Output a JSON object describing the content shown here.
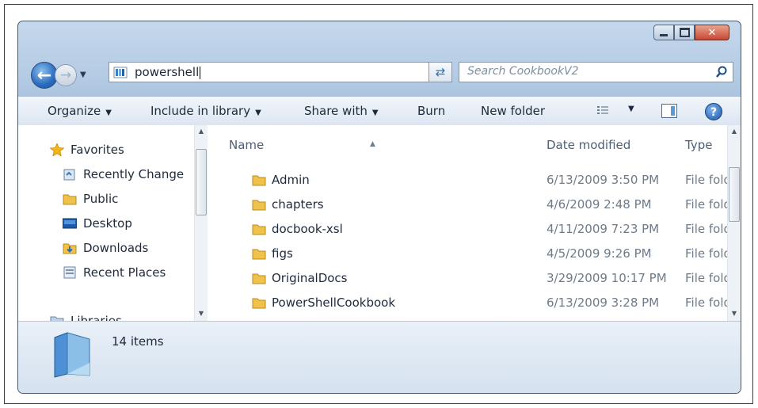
{
  "window": {
    "minimize_icon": "minimize-icon",
    "maximize_icon": "maximize-icon",
    "close_label": "✕"
  },
  "navigation": {
    "back_icon": "back-arrow-icon",
    "forward_icon": "forward-arrow-icon",
    "address_value": "powershell",
    "search_placeholder": "Search CookbookV2"
  },
  "toolbar": {
    "organize": "Organize",
    "include_in_library": "Include in library",
    "share_with": "Share with",
    "burn": "Burn",
    "new_folder": "New folder"
  },
  "sidebar": {
    "favorites": "Favorites",
    "items": [
      {
        "label": "Recently Change",
        "icon": "recent-changes-icon"
      },
      {
        "label": "Public",
        "icon": "folder-icon"
      },
      {
        "label": "Desktop",
        "icon": "desktop-icon"
      },
      {
        "label": "Downloads",
        "icon": "downloads-icon"
      },
      {
        "label": "Recent Places",
        "icon": "recent-places-icon"
      }
    ],
    "libraries": "Libraries"
  },
  "file_list": {
    "columns": {
      "name": "Name",
      "date": "Date modified",
      "type": "Type"
    },
    "rows": [
      {
        "name": "Admin",
        "date": "6/13/2009 3:50 PM",
        "type": "File folde"
      },
      {
        "name": "chapters",
        "date": "4/6/2009 2:48 PM",
        "type": "File folde"
      },
      {
        "name": "docbook-xsl",
        "date": "4/11/2009 7:23 PM",
        "type": "File folde"
      },
      {
        "name": "figs",
        "date": "4/5/2009 9:26 PM",
        "type": "File folde"
      },
      {
        "name": "OriginalDocs",
        "date": "3/29/2009 10:17 PM",
        "type": "File folde"
      },
      {
        "name": "PowerShellCookbook",
        "date": "6/13/2009 3:28 PM",
        "type": "File folde"
      }
    ]
  },
  "details": {
    "item_count": "14 items"
  },
  "colors": {
    "chrome": "#b9cfe6",
    "folder": "#f0c24a",
    "accent": "#2a6bbd"
  }
}
